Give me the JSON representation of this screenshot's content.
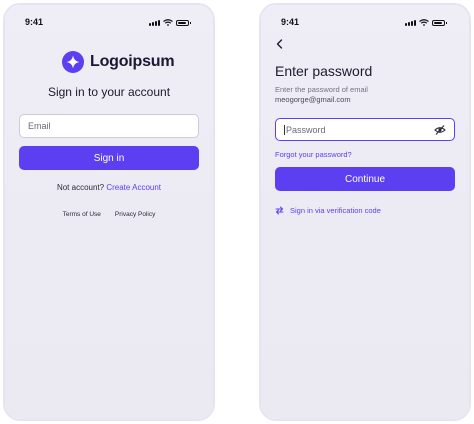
{
  "status": {
    "time": "9:41"
  },
  "login": {
    "brand": "Logoipsum",
    "title": "Sign in to your account",
    "email_placeholder": "Email",
    "signin_label": "Sign in",
    "no_account_text": "Not account?",
    "create_account_link": "Create Account",
    "terms": "Terms of Use",
    "privacy": "Privacy Policy"
  },
  "password": {
    "title": "Enter password",
    "subtitle": "Enter the password of email",
    "email": "meogorge@gmail.com",
    "placeholder": "Password",
    "forgot": "Forgot your password?",
    "continue_label": "Continue",
    "verify_link": "Sign in via verification code"
  },
  "colors": {
    "accent": "#5b3ff0",
    "background": "#eceaf3"
  },
  "icons": [
    "star-logo-icon",
    "back-arrow-icon",
    "eye-off-icon",
    "swap-icon",
    "signal-icon",
    "wifi-icon",
    "battery-icon"
  ]
}
